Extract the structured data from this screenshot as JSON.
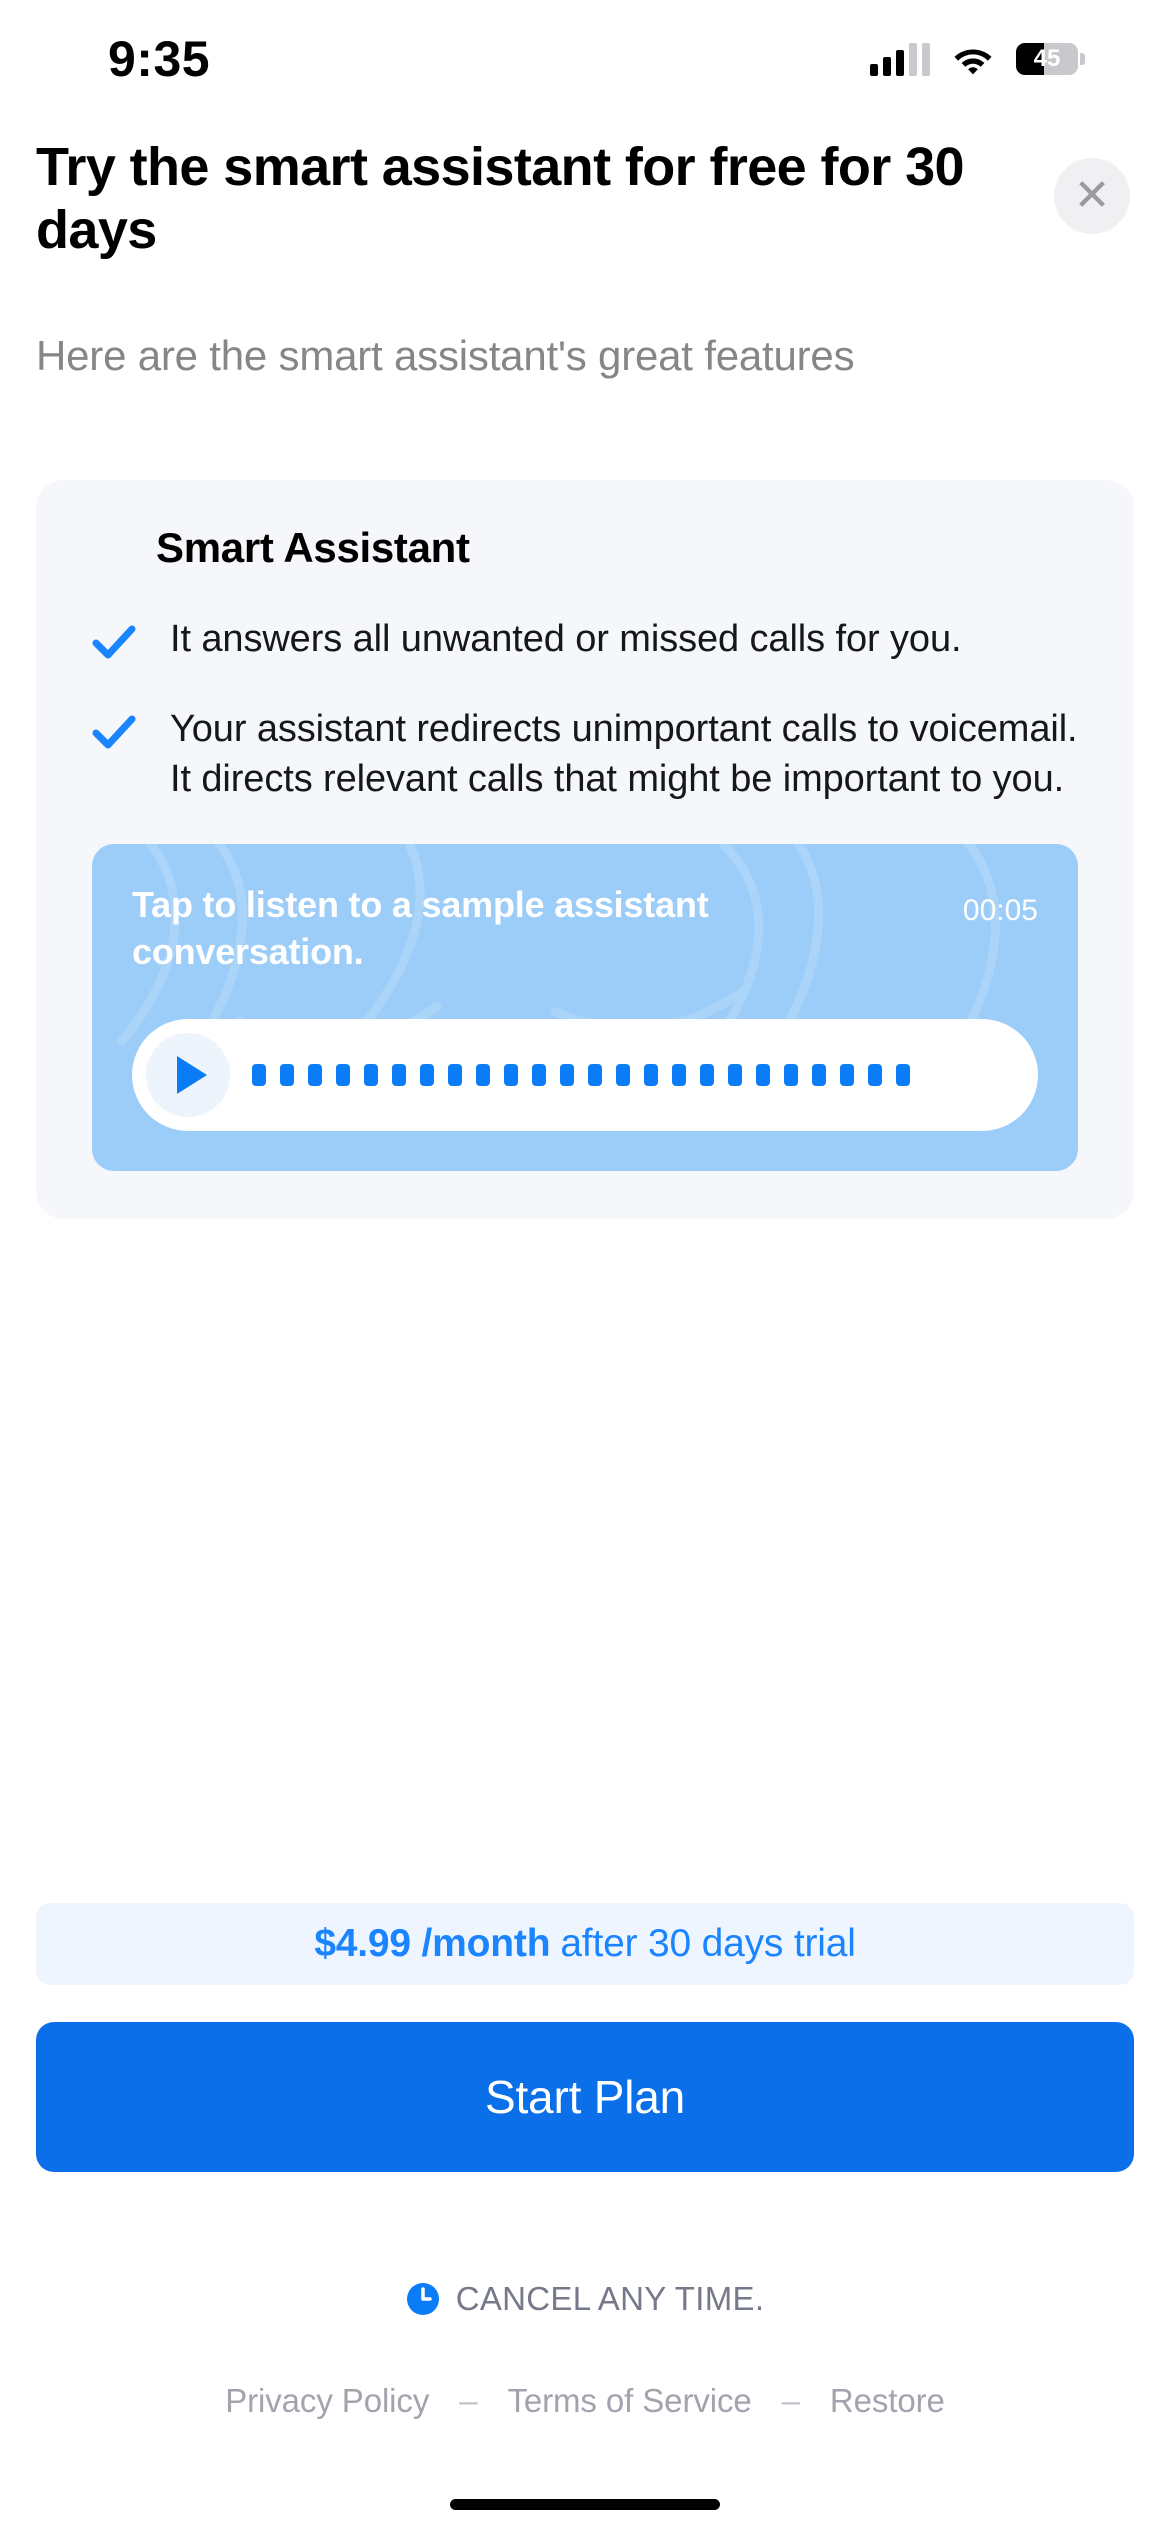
{
  "status_bar": {
    "time": "9:35",
    "signal_icon": "cellular-signal-icon",
    "wifi_icon": "wifi-icon",
    "battery_level": "45",
    "battery_percent": 45
  },
  "header": {
    "title": "Try the smart assistant for free for 30 days",
    "close_label": "✕",
    "subtitle": "Here are the smart assistant's great features"
  },
  "card": {
    "title": "Smart Assistant",
    "features": [
      {
        "check_icon": "check-icon",
        "text": "It answers all unwanted or missed calls for you."
      },
      {
        "check_icon": "check-icon",
        "text": "Your assistant redirects unimportant calls to voicemail. It directs relevant calls that might be important to you."
      }
    ],
    "player": {
      "label": "Tap to listen to a sample assistant conversation.",
      "duration": "00:05",
      "play_icon": "play-icon",
      "waveform_bars": 24
    }
  },
  "price_banner": {
    "amount": "$4.99 /month",
    "suffix": "after 30 days trial"
  },
  "cta": {
    "label": "Start Plan"
  },
  "cancel_note": {
    "icon": "clock-icon",
    "text": "CANCEL ANY TIME."
  },
  "footer": {
    "links": [
      {
        "label": "Privacy Policy"
      },
      {
        "label": "Terms of Service"
      },
      {
        "label": "Restore"
      }
    ],
    "separator": "–"
  },
  "colors": {
    "accent_blue": "#0a6fe8",
    "link_blue": "#1a85ff",
    "player_bg": "#9cccf8",
    "card_bg": "#f5f7fa",
    "banner_bg": "#eff5ff",
    "muted_text": "#868688"
  }
}
